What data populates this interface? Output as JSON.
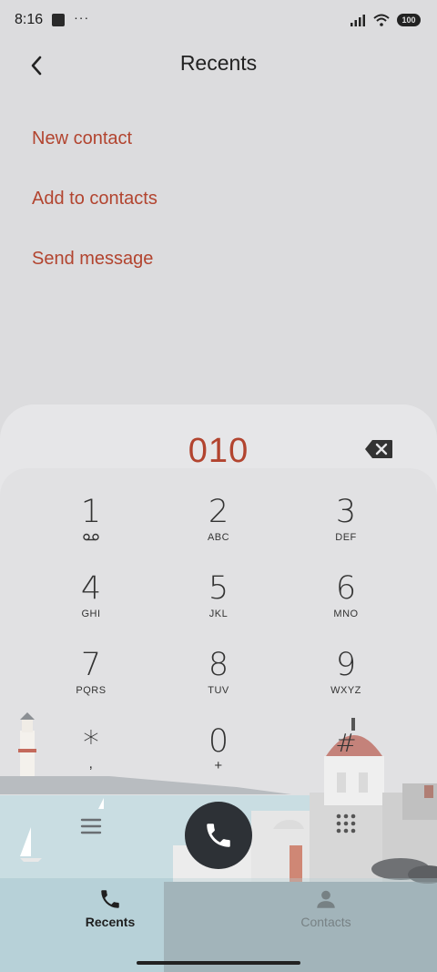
{
  "status_bar": {
    "time": "8:16",
    "dots": "···",
    "battery": "100"
  },
  "header": {
    "title": "Recents"
  },
  "options": [
    "New contact",
    "Add to contacts",
    "Send message"
  ],
  "dialer": {
    "number": "010",
    "keys": [
      {
        "digit": "1",
        "letters": ""
      },
      {
        "digit": "2",
        "letters": "ABC"
      },
      {
        "digit": "3",
        "letters": "DEF"
      },
      {
        "digit": "4",
        "letters": "GHI"
      },
      {
        "digit": "5",
        "letters": "JKL"
      },
      {
        "digit": "6",
        "letters": "MNO"
      },
      {
        "digit": "7",
        "letters": "PQRS"
      },
      {
        "digit": "8",
        "letters": "TUV"
      },
      {
        "digit": "9",
        "letters": "WXYZ"
      },
      {
        "digit": "*",
        "letters": ","
      },
      {
        "digit": "0",
        "letters": "+"
      },
      {
        "digit": "#",
        "letters": ""
      }
    ]
  },
  "bottom_nav": {
    "recents": "Recents",
    "contacts": "Contacts"
  },
  "colors": {
    "accent": "#b2442f",
    "call_button": "#2d3136"
  }
}
